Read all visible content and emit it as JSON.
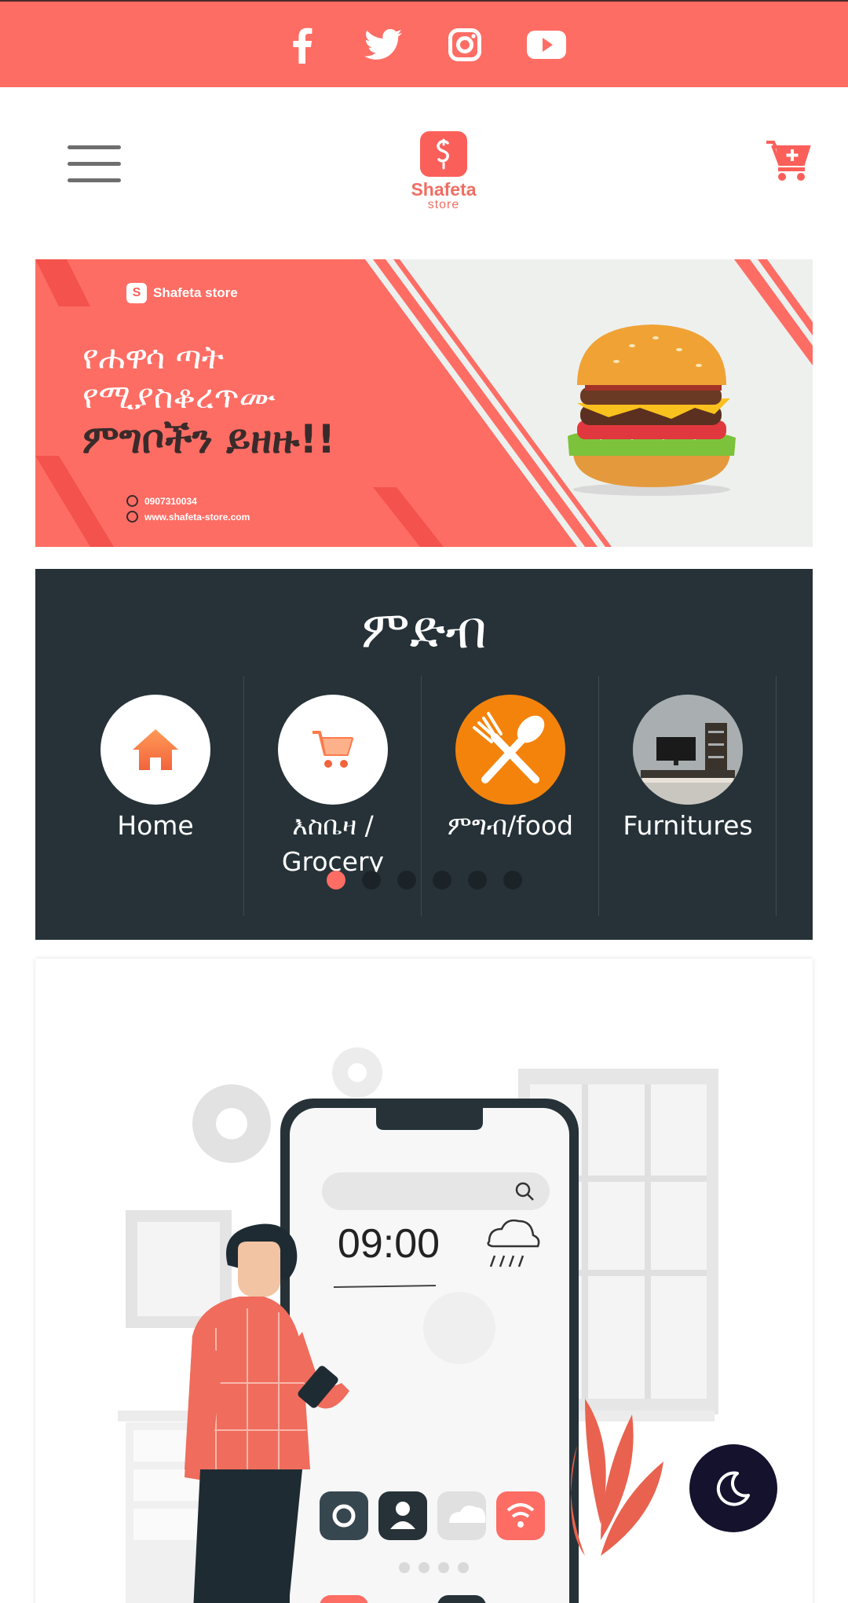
{
  "social": {
    "icons": [
      "facebook-icon",
      "twitter-icon",
      "instagram-icon",
      "youtube-icon"
    ]
  },
  "header": {
    "menu_icon": "hamburger-menu-icon",
    "logo_name": "Shafeta",
    "logo_sub": "store",
    "cart_icon": "cart-plus-icon"
  },
  "banner": {
    "brand": "Shafeta store",
    "line1": "የሐዋሳ ጣት",
    "line2": "የሚያስቆረጥሙ",
    "line3": "ምግቦችን ይዘዙ!!",
    "phone": "0907310034",
    "website": "www.shafeta-store.com"
  },
  "categories": {
    "title": "ምድብ",
    "items": [
      {
        "label": "Home",
        "icon": "home-icon"
      },
      {
        "label": "እስቤዛ / Grocery",
        "icon": "cart-icon"
      },
      {
        "label": "ምግብ/food",
        "icon": "fork-spoon-icon"
      },
      {
        "label": "Furnitures",
        "icon": "furniture-image"
      }
    ],
    "dots_count": 6,
    "active_dot": 0
  },
  "illustration": {
    "phone_time": "09:00"
  },
  "colors": {
    "brand": "#fe6d64",
    "dark_panel": "#263238",
    "food_orange": "#f4830c",
    "toggle_bg": "#14122d"
  }
}
